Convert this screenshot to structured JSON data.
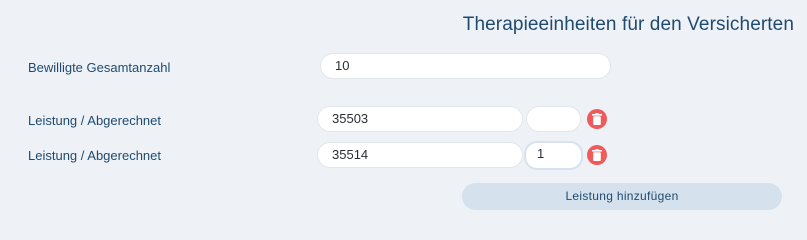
{
  "header": {
    "title": "Therapieeinheiten für den Versicherten"
  },
  "total": {
    "label": "Bewilligte Gesamtanzahl",
    "value": "10"
  },
  "rows": [
    {
      "label": "Leistung / Abgerechnet",
      "code": "35503",
      "count": ""
    },
    {
      "label": "Leistung / Abgerechnet",
      "code": "35514",
      "count": "1"
    }
  ],
  "actions": {
    "add_label": "Leistung hinzufügen"
  },
  "colors": {
    "background": "#eef2f6",
    "text": "#1f4a70",
    "delete": "#ef5a5a",
    "button": "#d5e1ec"
  },
  "icons": {
    "delete": "trash-icon"
  }
}
